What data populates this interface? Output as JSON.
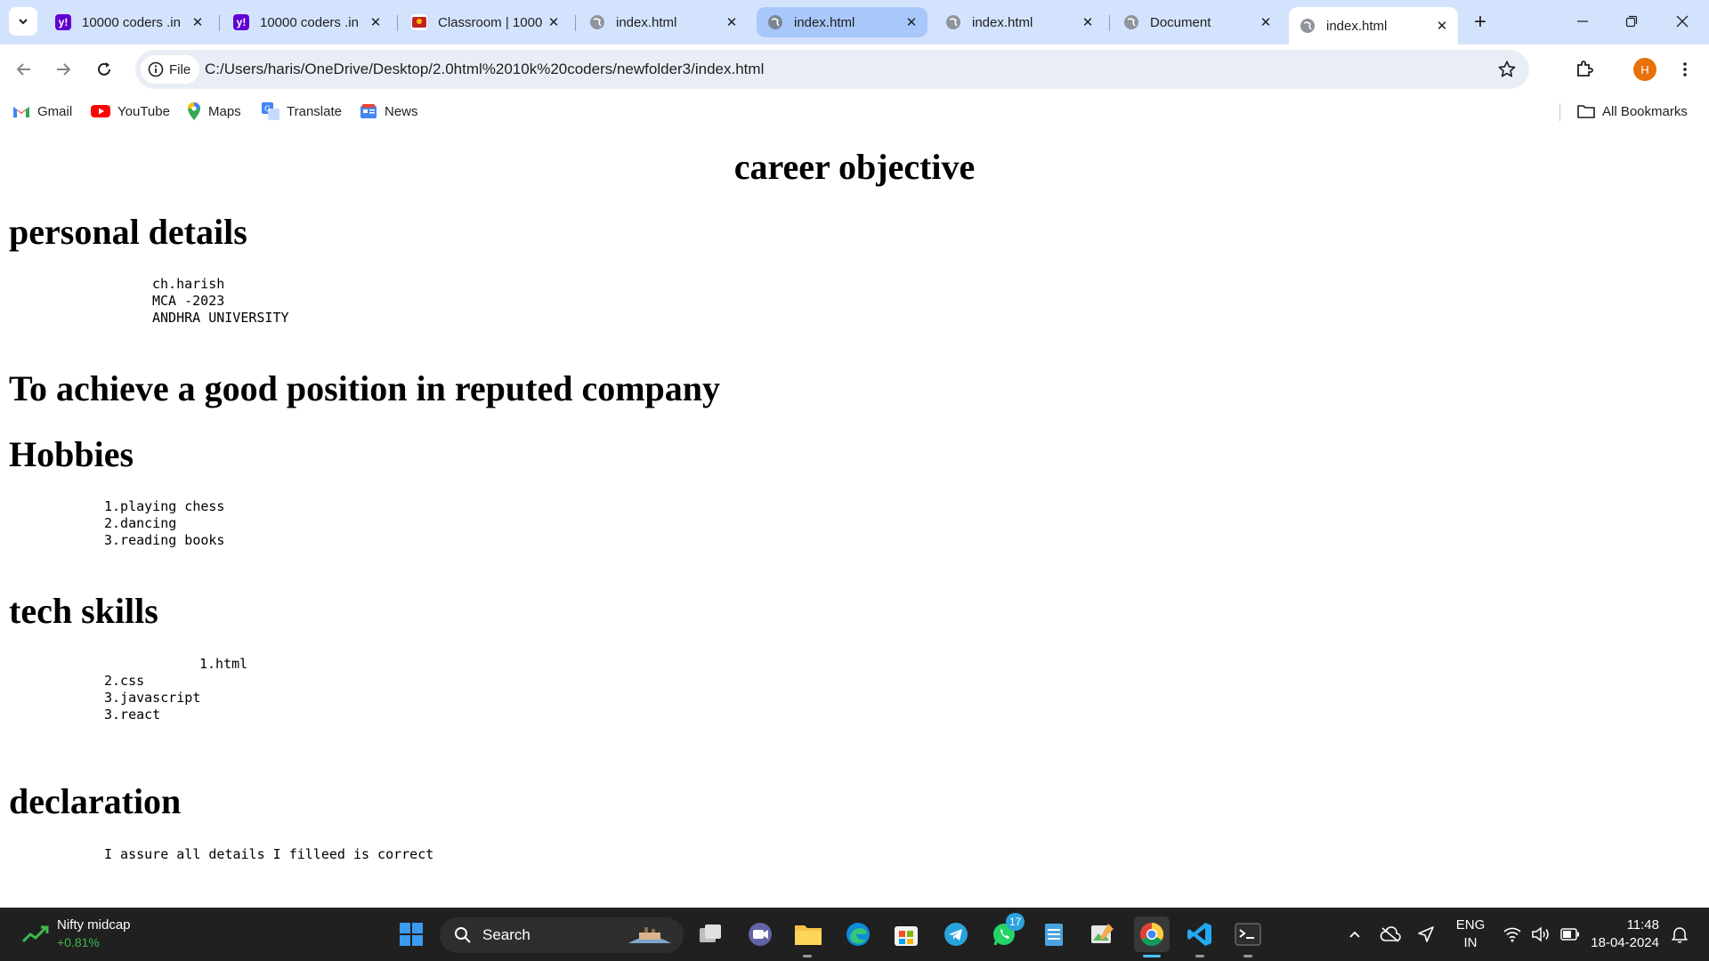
{
  "browser": {
    "tabs": [
      {
        "title": "10000 coders .in",
        "favicon": "yahoo-icon"
      },
      {
        "title": "10000 coders .in",
        "favicon": "yahoo-icon"
      },
      {
        "title": "Classroom | 1000",
        "favicon": "classroom-icon"
      },
      {
        "title": "index.html",
        "favicon": "globe-icon"
      },
      {
        "title": "index.html",
        "favicon": "globe-icon"
      },
      {
        "title": "index.html",
        "favicon": "globe-icon"
      },
      {
        "title": "Document",
        "favicon": "globe-icon"
      },
      {
        "title": "index.html",
        "favicon": "globe-icon"
      }
    ],
    "address_bar": {
      "chip_label": "File",
      "url": "C:/Users/haris/OneDrive/Desktop/2.0html%2010k%20coders/newfolder3/index.html"
    },
    "profile_initial": "H",
    "bookmarks": [
      {
        "label": "Gmail",
        "icon": "gmail-icon"
      },
      {
        "label": "YouTube",
        "icon": "youtube-icon"
      },
      {
        "label": "Maps",
        "icon": "maps-icon"
      },
      {
        "label": "Translate",
        "icon": "translate-icon"
      },
      {
        "label": "News",
        "icon": "news-icon"
      }
    ],
    "all_bookmarks_label": "All Bookmarks"
  },
  "page": {
    "career_objective_title": "career objective",
    "personal_details_title": "personal details",
    "personal_details": [
      "ch.harish",
      "MCA -2023",
      "ANDHRA UNIVERSITY"
    ],
    "objective_text": "To achieve a good position in reputed company",
    "hobbies_title": "Hobbies",
    "hobbies": [
      "1.playing chess",
      "2.dancing",
      "3.reading books"
    ],
    "tech_skills_title": "tech skills",
    "tech_skills": [
      "1.html",
      "2.css",
      "3.javascript",
      "3.react"
    ],
    "declaration_title": "declaration",
    "declaration_text": "I assure all details I filleed is correct"
  },
  "taskbar": {
    "widget_title": "Nifty midcap",
    "widget_value": "+0.81%",
    "search_placeholder": "Search",
    "whatsapp_badge": "17",
    "language_primary": "ENG",
    "language_secondary": "IN",
    "time": "11:48",
    "date": "18-04-2024"
  }
}
